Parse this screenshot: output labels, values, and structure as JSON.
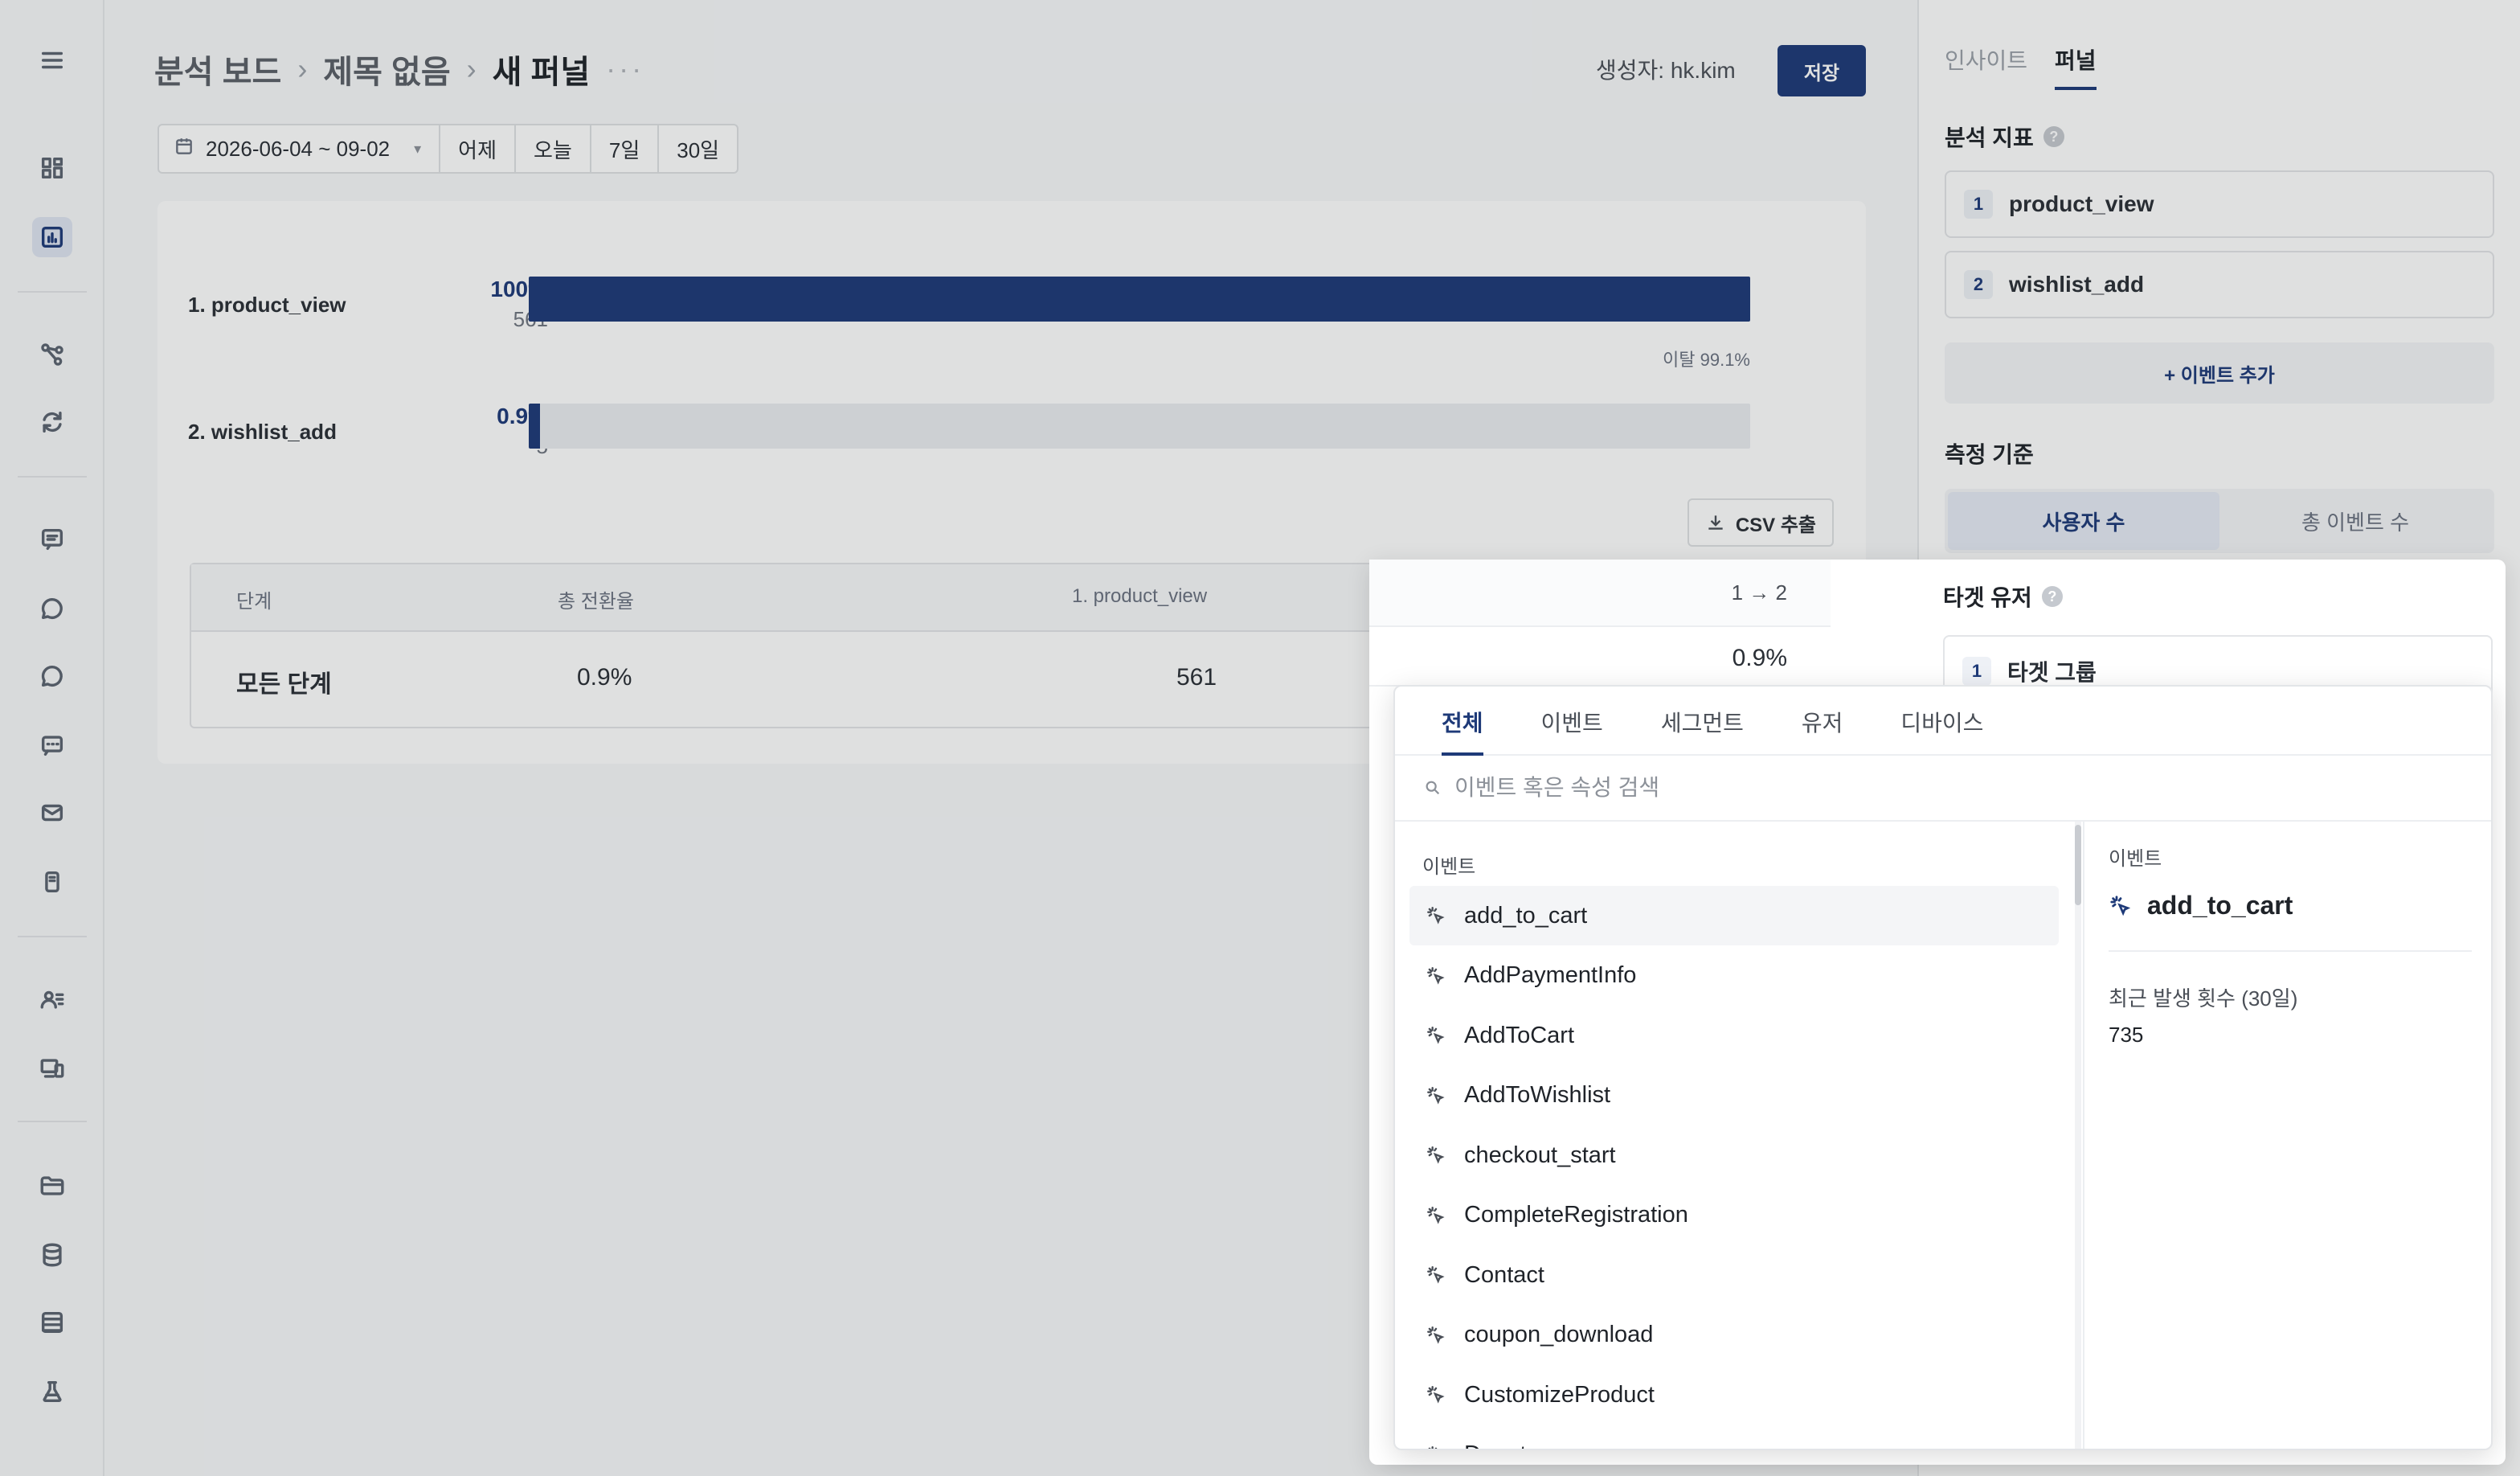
{
  "breadcrumb": {
    "items": [
      "분석 보드",
      "제목 없음"
    ],
    "current": "새 퍼널",
    "more": "···"
  },
  "header": {
    "creator": "생성자: hk.kim",
    "save_label": "저장"
  },
  "date_filter": {
    "range": "2026-06-04 ~ 09-02",
    "quick": [
      "어제",
      "오늘",
      "7일",
      "30일"
    ]
  },
  "funnel": {
    "steps": [
      {
        "label": "1. product_view",
        "pct": "100%",
        "count": "561",
        "ratio": 1.0
      },
      {
        "label": "2. wishlist_add",
        "pct": "0.9%",
        "count": "5",
        "ratio": 0.009
      }
    ],
    "dropoff": "이탈 99.1%",
    "csv_label": "CSV 추출",
    "table": {
      "headers": [
        "단계",
        "총 전환율",
        "1. product_view"
      ],
      "row": [
        "모든 단계",
        "0.9%",
        "561"
      ]
    }
  },
  "overlay_step": {
    "header": "1 → 2",
    "value": "0.9%"
  },
  "right_panel": {
    "tabs": [
      "인사이트",
      "퍼널"
    ],
    "active_tab": 1,
    "metrics_title": "분석 지표",
    "metrics": [
      {
        "num": "1",
        "name": "product_view"
      },
      {
        "num": "2",
        "name": "wishlist_add"
      }
    ],
    "add_event": "+ 이벤트 추가",
    "measure_title": "측정 기준",
    "measure_options": [
      "사용자 수",
      "총 이벤트 수"
    ],
    "target_title": "타겟 유저",
    "target_group": {
      "num": "1",
      "name": "타겟 그룹"
    }
  },
  "picker": {
    "tabs": [
      "전체",
      "이벤트",
      "세그먼트",
      "유저",
      "디바이스"
    ],
    "active_tab": 0,
    "search_placeholder": "이벤트 혹은 속성 검색",
    "list_title": "이벤트",
    "events": [
      "add_to_cart",
      "AddPaymentInfo",
      "AddToCart",
      "AddToWishlist",
      "checkout_start",
      "CompleteRegistration",
      "Contact",
      "coupon_download",
      "CustomizeProduct",
      "Donate"
    ],
    "hovered_index": 0,
    "detail": {
      "label": "이벤트",
      "name": "add_to_cart",
      "stat_label": "최근 발생 횟수 (30일)",
      "stat_value": "735"
    }
  },
  "colors": {
    "accent": "#1e3a78",
    "bar_track": "#ebedf0"
  },
  "icons": {
    "sidebar": [
      "menu-icon",
      "dashboard-icon",
      "chart-icon",
      "flow-icon",
      "refresh-icon",
      "board-icon",
      "chat-icon",
      "chat-icon",
      "message-icon",
      "mail-icon",
      "mobile-icon",
      "users-icon",
      "devices-icon",
      "folder-icon",
      "database-icon",
      "table-icon",
      "flask-icon"
    ]
  }
}
